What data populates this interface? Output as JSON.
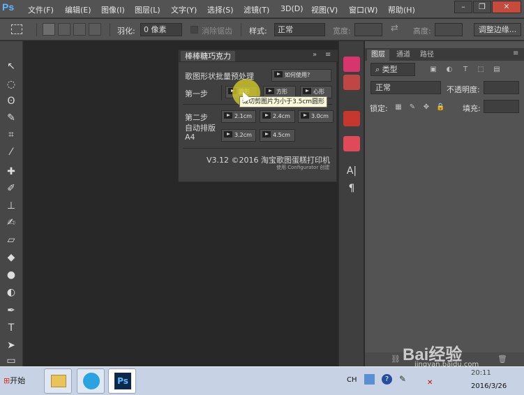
{
  "app": {
    "logo": "Ps"
  },
  "menu": [
    "文件(F)",
    "编辑(E)",
    "图像(I)",
    "图层(L)",
    "文字(Y)",
    "选择(S)",
    "滤镜(T)",
    "3D(D)",
    "视图(V)",
    "窗口(W)",
    "帮助(H)"
  ],
  "window_controls": [
    "–",
    "❐",
    "✕"
  ],
  "options": {
    "feather_label": "羽化:",
    "feather_value": "0 像素",
    "antialias_label": "消除锯齿",
    "style_label": "样式:",
    "style_value": "正常",
    "width_label": "宽度:",
    "height_label": "高度:",
    "refine_button": "调整边缘..."
  },
  "plugin": {
    "tab": "棒棒糖巧克力",
    "heading": "歌图形状批量预处理",
    "help_button": "如何使用?",
    "step1_label": "第一步",
    "shape_buttons": [
      "圆形",
      "方形",
      "心形"
    ],
    "tooltip": "裁切剪图片为小于3.5cm圆形",
    "step2_label": "第二步",
    "auto_label": "自动排版",
    "paper_label": "A4",
    "size_buttons": [
      "2.1cm",
      "2.4cm",
      "3.0cm",
      "3.2cm",
      "4.5cm"
    ],
    "version": "V3.12 ©2016 淘宝歌图蛋糕打印机",
    "credit": "使用 Configurator 创建"
  },
  "layers_panel": {
    "tabs": [
      "图层",
      "通道",
      "路径"
    ],
    "filter_label": "类型",
    "blend_mode": "正常",
    "opacity_label": "不透明度:",
    "lock_label": "锁定:",
    "fill_label": "填充:"
  },
  "taskbar": {
    "start": "开始",
    "lang": "CH",
    "time": "20:11",
    "date": "2016/3/26"
  },
  "watermark": {
    "text": "Bai经验",
    "url": "jingyan.baidu.com"
  },
  "colors": {
    "strip_icons": [
      "#d8356e",
      "#c04545",
      "#c8372e",
      "#e04a58"
    ]
  }
}
